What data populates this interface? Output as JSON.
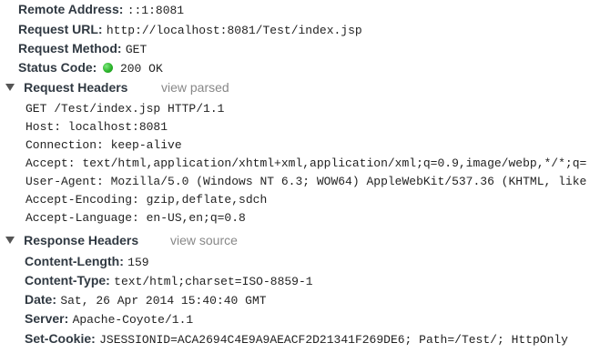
{
  "general": {
    "remote_address": {
      "label": "Remote Address:",
      "value": "::1:8081"
    },
    "request_url": {
      "label": "Request URL:",
      "value": "http://localhost:8081/Test/index.jsp"
    },
    "request_method": {
      "label": "Request Method:",
      "value": "GET"
    },
    "status_code": {
      "label": "Status Code:",
      "value": "200 OK",
      "dot_color": "#2cb52c"
    }
  },
  "request_headers": {
    "title": "Request Headers",
    "toggle_label": "view parsed",
    "lines": [
      "GET /Test/index.jsp HTTP/1.1",
      "Host: localhost:8081",
      "Connection: keep-alive",
      "Accept: text/html,application/xhtml+xml,application/xml;q=0.9,image/webp,*/*;q=",
      "User-Agent: Mozilla/5.0 (Windows NT 6.3; WOW64) AppleWebKit/537.36 (KHTML, like",
      "Accept-Encoding: gzip,deflate,sdch",
      "Accept-Language: en-US,en;q=0.8"
    ]
  },
  "response_headers": {
    "title": "Response Headers",
    "toggle_label": "view source",
    "items": [
      {
        "label": "Content-Length:",
        "value": "159"
      },
      {
        "label": "Content-Type:",
        "value": "text/html;charset=ISO-8859-1"
      },
      {
        "label": "Date:",
        "value": "Sat, 26 Apr 2014 15:40:40 GMT"
      },
      {
        "label": "Server:",
        "value": "Apache-Coyote/1.1"
      },
      {
        "label": "Set-Cookie:",
        "value": "JSESSIONID=ACA2694C4E9A9AEACF2D21341F269DE6; Path=/Test/; HttpOnly"
      }
    ]
  },
  "colors": {
    "label": "#303942",
    "value": "#222222",
    "link": "#888888",
    "status_ok": "#2cb52c"
  }
}
